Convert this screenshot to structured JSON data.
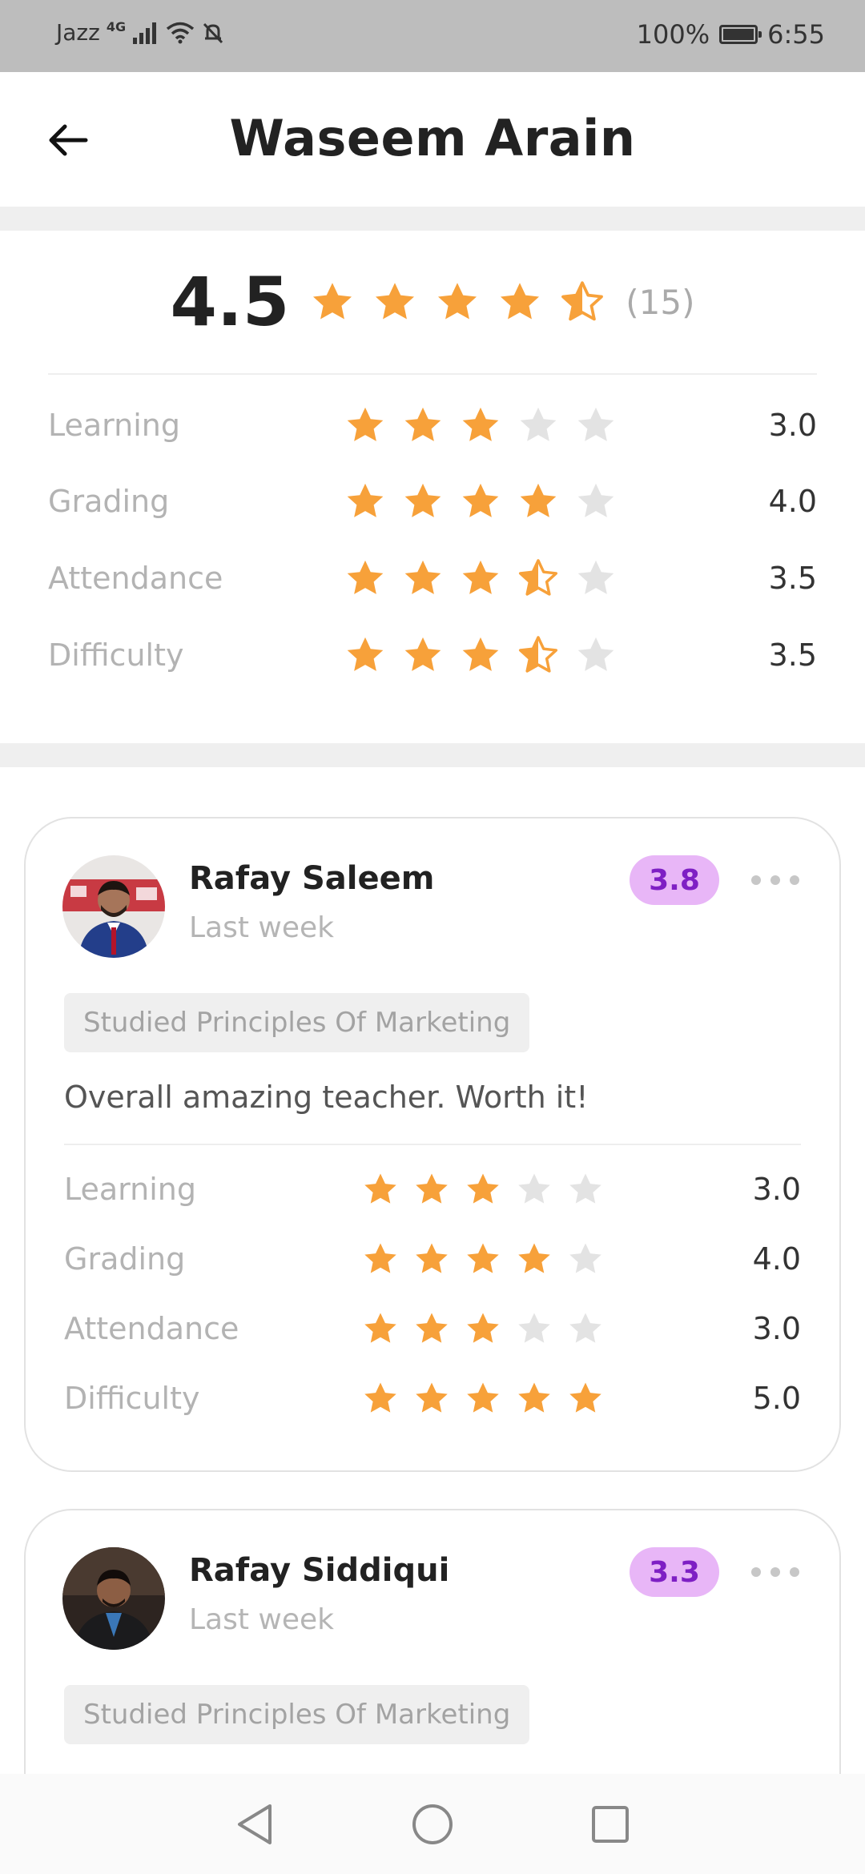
{
  "status_bar": {
    "carrier": "Jazz",
    "network": "4G",
    "battery": "100%",
    "time": "6:55"
  },
  "header": {
    "back_icon": "arrow-left-icon",
    "title": "Waseem Arain"
  },
  "summary": {
    "overall": "4.5",
    "overall_stars": 4.5,
    "count": "(15)",
    "categories": [
      {
        "label": "Learning",
        "value": "3.0",
        "stars": 3
      },
      {
        "label": "Grading",
        "value": "4.0",
        "stars": 4
      },
      {
        "label": "Attendance",
        "value": "3.5",
        "stars": 3.5
      },
      {
        "label": "Difficulty",
        "value": "3.5",
        "stars": 3.5
      }
    ]
  },
  "reviews": [
    {
      "name": "Rafay Saleem",
      "time": "Last week",
      "rating": "3.8",
      "course": "Studied Principles Of Marketing",
      "text": "Overall amazing teacher. Worth it!",
      "categories": [
        {
          "label": "Learning",
          "value": "3.0",
          "stars": 3
        },
        {
          "label": "Grading",
          "value": "4.0",
          "stars": 4
        },
        {
          "label": "Attendance",
          "value": "3.0",
          "stars": 3
        },
        {
          "label": "Difficulty",
          "value": "5.0",
          "stars": 5
        }
      ]
    },
    {
      "name": "Rafay Siddiqui",
      "time": "Last week",
      "rating": "3.3",
      "course": "Studied Principles Of Marketing"
    }
  ],
  "colors": {
    "star_filled": "#f7a13a",
    "star_empty": "#e3e3e3",
    "badge_bg": "#e8b6f7",
    "badge_text": "#7e1fc4"
  }
}
